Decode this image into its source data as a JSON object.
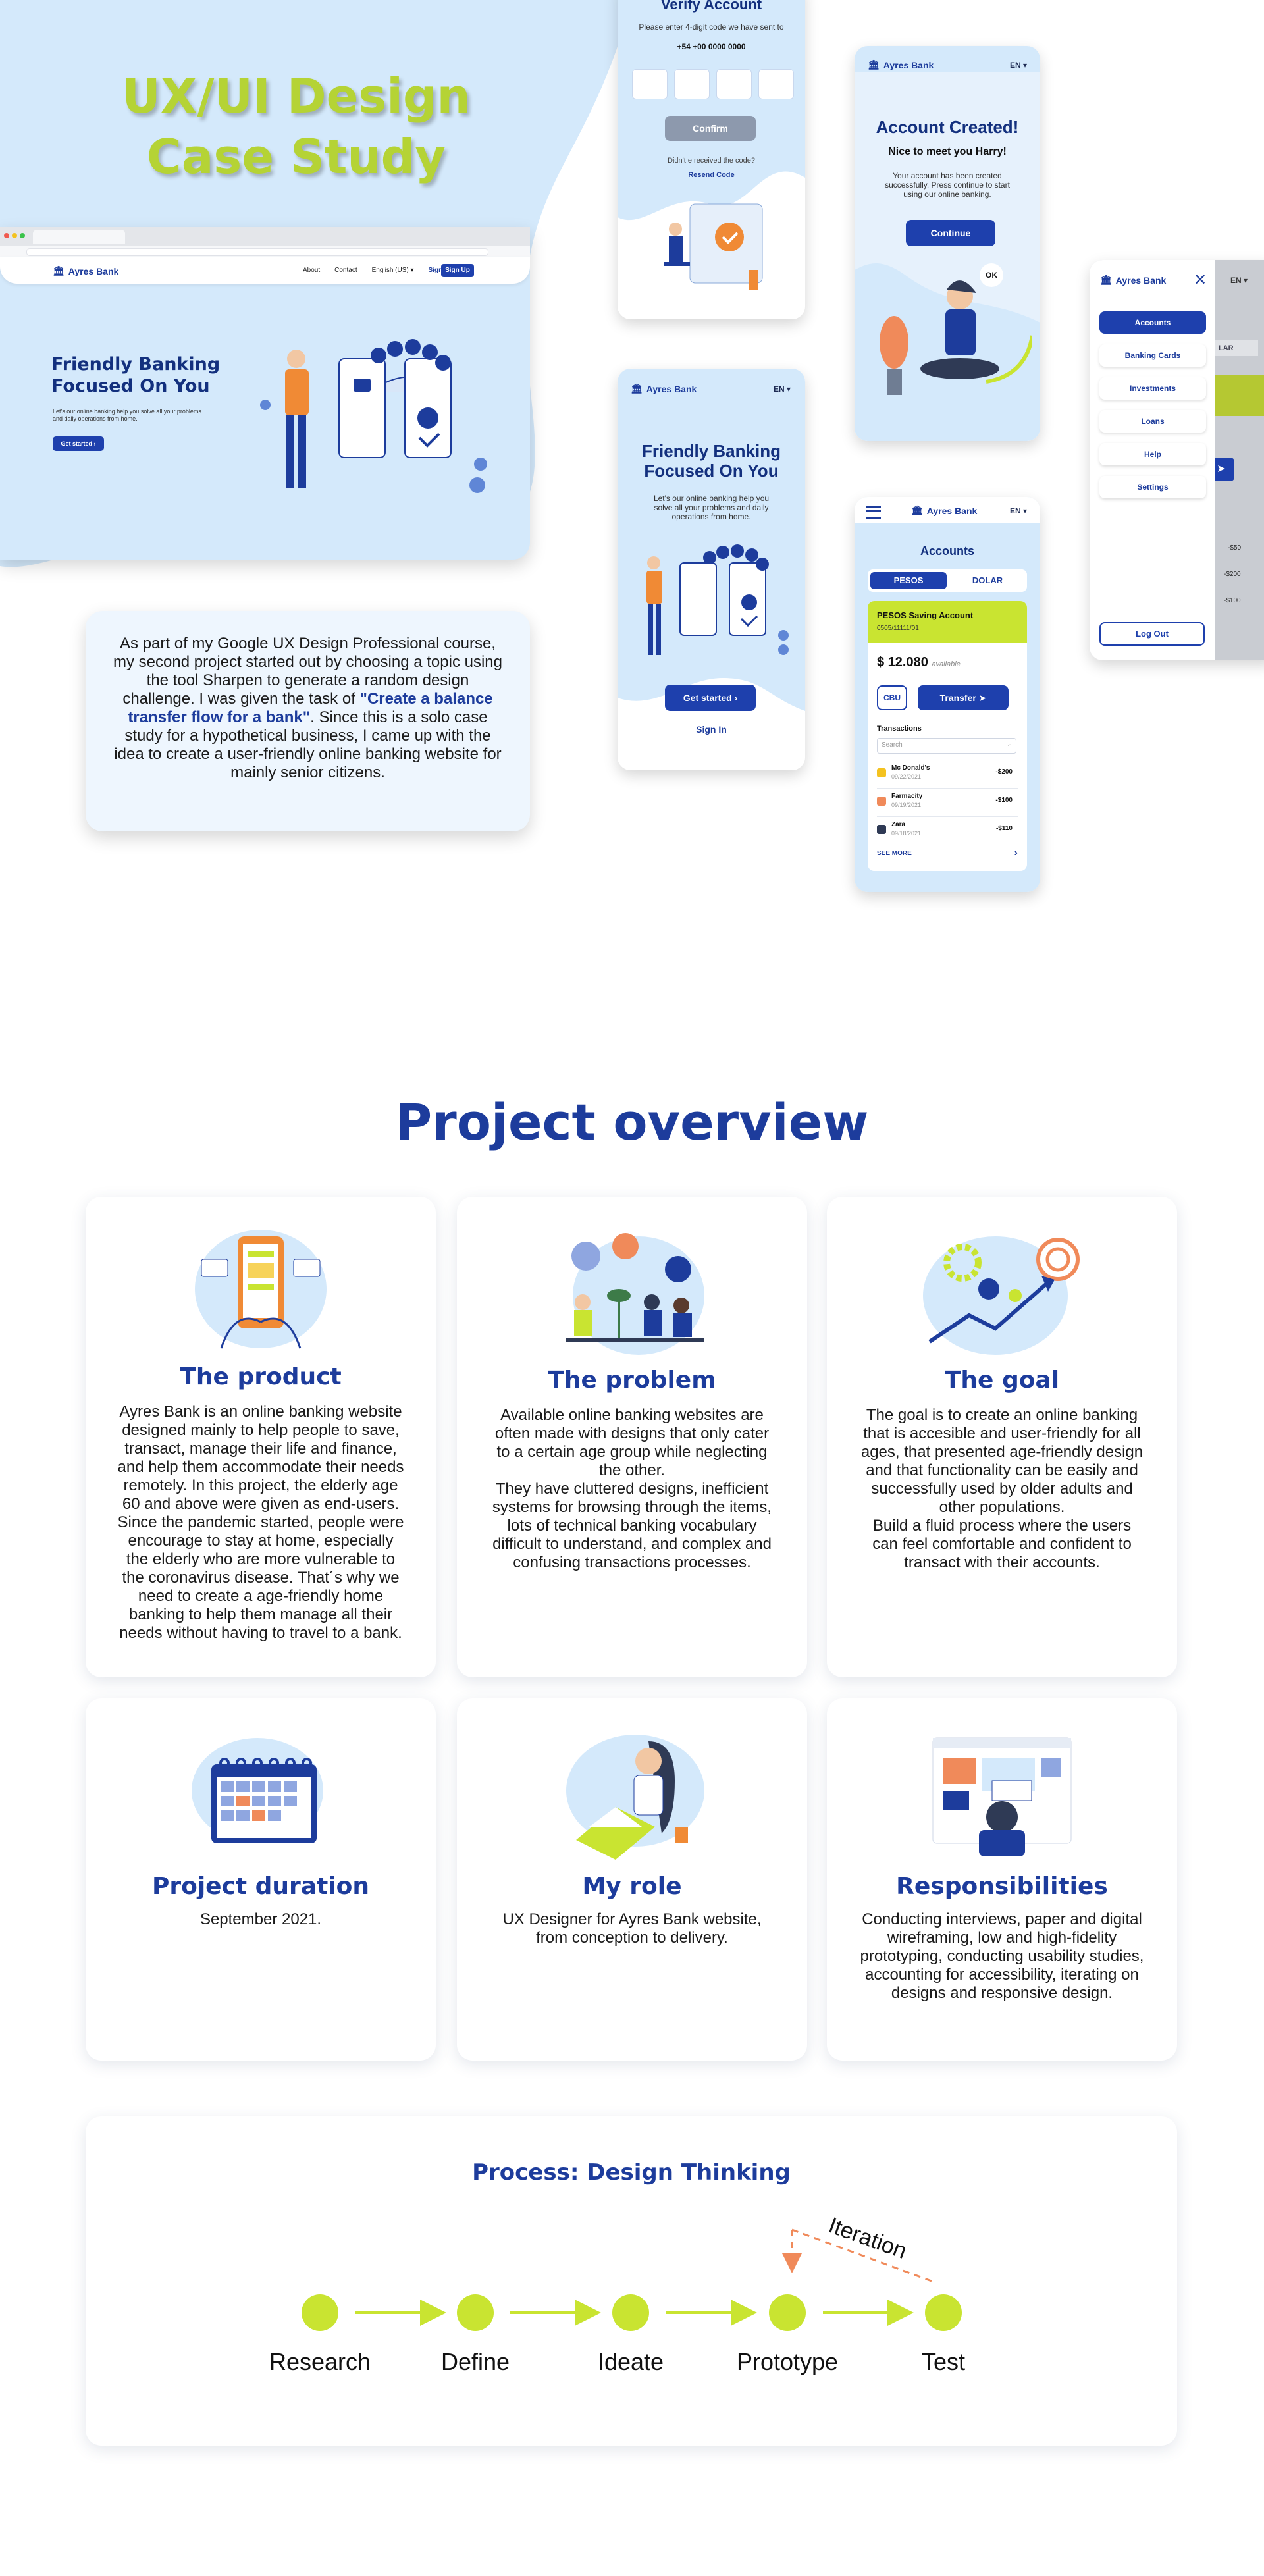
{
  "hero": {
    "title_line1": "UX/UI Design",
    "title_line2": "Case Study",
    "intro_text_1": "As part of my Google UX Design Professional course, my second project started out by choosing a topic using the tool Sharpen to generate a random design challenge. I was given the task of",
    "intro_highlight": "\"Create a balance transfer flow for a bank\"",
    "intro_text_2": ". Since this is a solo case study for a hypothetical business, I came up with the idea to create a user-friendly online banking website for mainly senior citizens."
  },
  "desktop_mock": {
    "brand": "Ayres Bank",
    "nav": [
      "About",
      "Contact",
      "English (US) ▾",
      "Sign In"
    ],
    "signup": "Sign Up",
    "headline": "Friendly Banking Focused On You",
    "subtext": "Let's our online banking help you solve all your problems and daily operations from home.",
    "cta": "Get started ›"
  },
  "phone_verify": {
    "title": "Verify Account",
    "instruction": "Please enter 4-digit code we have sent to",
    "phone_number": "+54 +00 0000 0000",
    "confirm": "Confirm",
    "not_received": "Didn't e received the code?",
    "resend": "Resend Code"
  },
  "phone_home": {
    "brand": "Ayres Bank",
    "lang": "EN ▾",
    "headline": "Friendly Banking Focused On You",
    "subtext": "Let's our online banking help you solve all your problems and daily operations from home.",
    "cta": "Get started ›",
    "signin": "Sign In"
  },
  "phone_created": {
    "brand": "Ayres Bank",
    "lang": "EN ▾",
    "title": "Account Created!",
    "greeting": "Nice to meet you Harry!",
    "body": "Your account has been created successfully. Press continue to start using our online banking.",
    "cta": "Continue",
    "bubble": "OK"
  },
  "phone_accounts": {
    "brand": "Ayres Bank",
    "lang": "EN ▾",
    "title": "Accounts",
    "tab_active": "PESOS",
    "tab_other": "DOLAR",
    "account_name": "PESOS Saving Account",
    "account_number": "0505/11111/01",
    "balance": "$ 12.080",
    "balance_note": "available",
    "cbu": "CBU",
    "transfer": "Transfer",
    "transactions_label": "Transactions",
    "search_placeholder": "Search",
    "transactions": [
      {
        "name": "Mc Donald's",
        "date": "09/22/2021",
        "amount": "-$200"
      },
      {
        "name": "Farmacity",
        "date": "09/19/2021",
        "amount": "-$100"
      },
      {
        "name": "Zara",
        "date": "09/18/2021",
        "amount": "-$110"
      }
    ],
    "see_more": "SEE MORE"
  },
  "phone_menu": {
    "brand": "Ayres Bank",
    "lang": "EN ▾",
    "items": [
      "Accounts",
      "Banking Cards",
      "Investments",
      "Loans",
      "Help",
      "Settings"
    ],
    "logout": "Log Out",
    "peek_tab": "LAR",
    "peek_amounts": [
      "-$50",
      "-$200",
      "-$100"
    ]
  },
  "overview": {
    "title": "Project overview",
    "cards": [
      {
        "title": "The product",
        "body": "Ayres Bank is an online banking website designed mainly to help people to save, transact, manage their life and finance, and help them accommodate their needs remotely. In this project, the elderly age 60 and above were given as end-users. Since the pandemic started, people were encourage to stay at home, especially the elderly who are more vulnerable to the coronavirus disease. That´s why we need to create a age-friendly home banking to help them manage all their needs without having to travel to a bank."
      },
      {
        "title": "The problem",
        "body": "Available online banking websites are often made with designs that only cater to a certain age group while neglecting the other.\nThey have cluttered designs, inefficient systems for browsing through the items, lots of technical banking vocabulary difficult to understand, and complex and confusing transactions processes."
      },
      {
        "title": "The goal",
        "body": "The goal is to create an online banking that is accesible and user-friendly for all ages, that presented age-friendly design and that functionality can be easily and successfully used by older adults and other populations.\nBuild a fluid process where the users can feel comfortable and confident to transact with their accounts."
      },
      {
        "title": "Project duration",
        "body": "September 2021."
      },
      {
        "title": "My role",
        "body": "UX Designer for Ayres Bank website, from conception to delivery."
      },
      {
        "title": "Responsibilities",
        "body": "Conducting interviews, paper and digital wireframing, low and high-fidelity prototyping, conducting usability studies, accounting for accessibility, iterating on designs and responsive design."
      }
    ]
  },
  "process": {
    "title": "Process: Design Thinking",
    "iteration_label": "Iteration",
    "steps": [
      "Research",
      "Define",
      "Ideate",
      "Prototype",
      "Test"
    ]
  },
  "colors": {
    "navy": "#1d3c9c",
    "lime": "#c9e431",
    "light_blue": "#d4e9fb"
  }
}
